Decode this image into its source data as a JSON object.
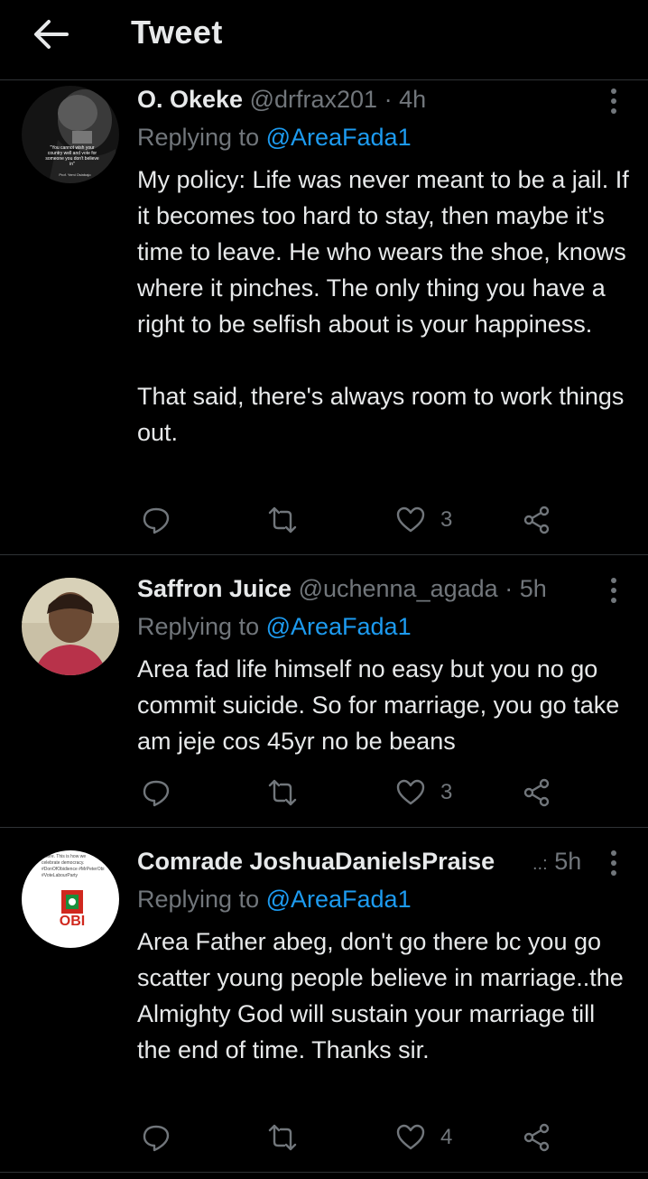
{
  "header": {
    "title": "Tweet"
  },
  "tweets": [
    {
      "name": "O. Okeke",
      "handle": "@drfrax201",
      "time": "4h",
      "replying_prefix": "Replying to ",
      "replying_to": "@AreaFada1",
      "text": "My policy: Life was never meant to be a jail. If it becomes too hard to stay, then maybe it's time to leave. He who wears the shoe, knows where it pinches. The only thing you have a right to be selfish about is your happiness.\n\nThat said, there's always room to work things out.",
      "likes": "3",
      "avatar_quote": "\"You cannot wish your country well and vote for someone you don't believe in\"",
      "avatar_caption": "Prof. Yemi Osinbajo"
    },
    {
      "name": "Saffron Juice",
      "handle": "@uchenna_agada",
      "time": "5h",
      "replying_prefix": "Replying to ",
      "replying_to": "@AreaFada1",
      "text": "Area fad life himself no easy but you no go commit suicide. So for marriage, you go take am jeje cos 45yr no be beans",
      "likes": "3"
    },
    {
      "name": "Comrade JoshuaDanielsPraise",
      "handle": "..:",
      "time": "5h",
      "replying_prefix": "Replying to ",
      "replying_to": "@AreaFada1",
      "text": "Area Father abeg, don't go there bc you go scatter young people believe in marriage..the Almighty God will sustain your marriage till the end of time. Thanks sir.",
      "likes": "4",
      "avatar_text": "where. This is how we celebrate democracy. #DonOfObidience #MrPeterObi #VoteLabourParty",
      "avatar_logo": "OBI"
    }
  ],
  "colors": {
    "accent": "#1d9bf0",
    "muted": "#71767b",
    "text": "#e7e9ea",
    "divider": "#2f3336",
    "lp_red": "#d0281e",
    "lp_green": "#1a8f3c"
  }
}
